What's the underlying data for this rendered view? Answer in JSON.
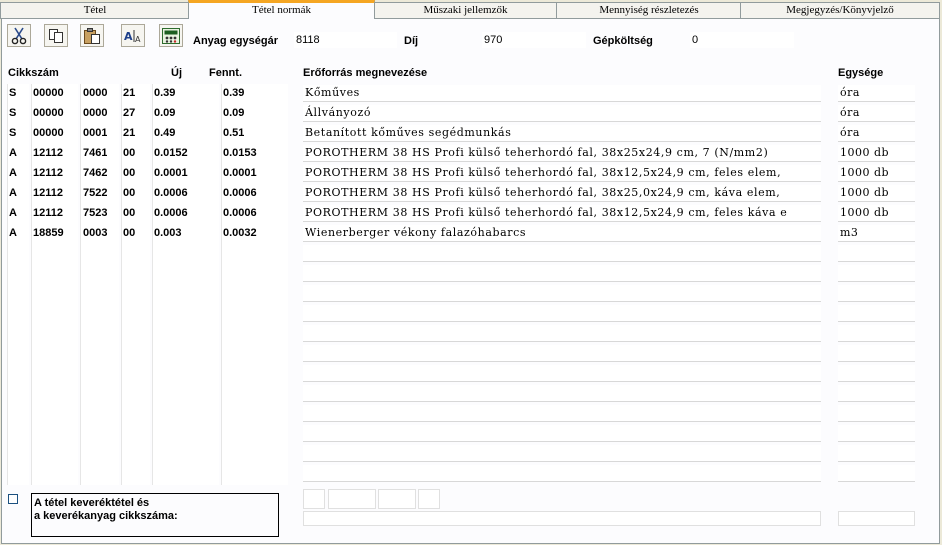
{
  "tabs": [
    {
      "label": "Tétel",
      "active": false
    },
    {
      "label": "Tétel normák",
      "active": true
    },
    {
      "label": "Műszaki jellemzők",
      "active": false
    },
    {
      "label": "Mennyiség részletezés",
      "active": false
    },
    {
      "label": "Megjegyzés/Könyvjelző",
      "active": false
    }
  ],
  "toolbar": {
    "icons": [
      "scissors-icon",
      "copy-icon",
      "paste-icon",
      "font-size-icon",
      "calculator-icon"
    ]
  },
  "summary": {
    "anyag_label": "Anyag egységár",
    "anyag_value": "8118",
    "dij_label": "Díj",
    "dij_value": "970",
    "gep_label": "Gépköltség",
    "gep_value": "0"
  },
  "headers": {
    "cikkszam": "Cikkszám",
    "uj": "Új",
    "fennt": "Fennt.",
    "eroforras": "Erőforrás megnevezése",
    "egysege": "Egysége"
  },
  "rows": [
    {
      "type": "S",
      "c1": "00000",
      "c2": "0000",
      "c3": "21",
      "uj": "0.39",
      "fennt": "0.39",
      "name": "Kőműves",
      "unit": "óra"
    },
    {
      "type": "S",
      "c1": "00000",
      "c2": "0000",
      "c3": "27",
      "uj": "0.09",
      "fennt": "0.09",
      "name": "Állványozó",
      "unit": "óra"
    },
    {
      "type": "S",
      "c1": "00000",
      "c2": "0001",
      "c3": "21",
      "uj": "0.49",
      "fennt": "0.51",
      "name": "Betanított kőműves segédmunkás",
      "unit": "óra"
    },
    {
      "type": "A",
      "c1": "12112",
      "c2": "7461",
      "c3": "00",
      "uj": "0.0152",
      "fennt": "0.0153",
      "name": "POROTHERM 38 HS Profi külső teherhordó fal, 38x25x24,9 cm, 7 (N/mm2)",
      "unit": "1000 db"
    },
    {
      "type": "A",
      "c1": "12112",
      "c2": "7462",
      "c3": "00",
      "uj": "0.0001",
      "fennt": "0.0001",
      "name": "POROTHERM 38 HS Profi külső teherhordó fal, 38x12,5x24,9 cm, feles elem,",
      "unit": "1000 db"
    },
    {
      "type": "A",
      "c1": "12112",
      "c2": "7522",
      "c3": "00",
      "uj": "0.0006",
      "fennt": "0.0006",
      "name": "POROTHERM 38 HS Profi külső teherhordó fal, 38x25,0x24,9 cm, káva elem,",
      "unit": "1000 db"
    },
    {
      "type": "A",
      "c1": "12112",
      "c2": "7523",
      "c3": "00",
      "uj": "0.0006",
      "fennt": "0.0006",
      "name": "POROTHERM 38 HS Profi külső teherhordó fal, 38x12,5x24,9 cm, feles káva e",
      "unit": "1000 db"
    },
    {
      "type": "A",
      "c1": "18859",
      "c2": "0003",
      "c3": "00",
      "uj": "0.003",
      "fennt": "0.0032",
      "name": "Wienerberger vékony falazóhabarcs",
      "unit": "m3"
    }
  ],
  "footer": {
    "keverek_label_line1": "A tétel keveréktétel és",
    "keverek_label_line2": "a keverékanyag cikkszáma:"
  }
}
